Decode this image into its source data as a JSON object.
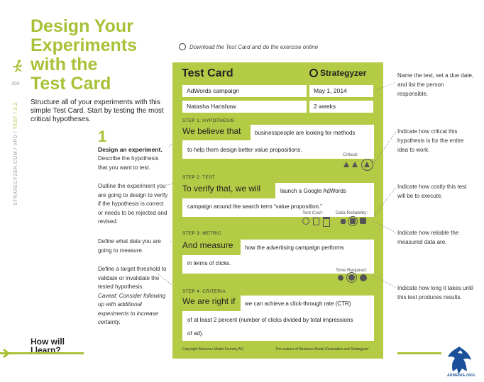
{
  "page": {
    "title_lines": [
      "Design Your",
      "Experiments",
      "with the",
      "Test Card"
    ],
    "page_number": "204",
    "side_text_main": "STRATEGYZER.COM / VPD / ",
    "side_text_accent": "TEST / 3.2",
    "intro": "Structure all of your experiments with this simple Test Card. Start by testing the most critical hypotheses.",
    "step_number": "1",
    "step_heading": "Design an experiment.",
    "step_desc": "Describe the hypothesis that you want to test.",
    "left_notes": [
      "Outline the experiment you are going to design to verify if the hypothesis is correct or needs to be rejected and revised.",
      "Define what data you are going to measure."
    ],
    "threshold_note": "Define a target threshold to validate or invalidate the tested hypothesis.",
    "caveat_note": "Caveat: Consider following up with additional experiments to increase certainty.",
    "how_will": [
      "How will",
      "I learn?"
    ],
    "download": "Download the Test Card and do the exercise online"
  },
  "card": {
    "title": "Test Card",
    "brand": "Strategyzer",
    "test_name": "AdWords campaign",
    "date": "May 1, 2014",
    "person": "Natasha Hanshaw",
    "duration": "2 weeks",
    "step1": {
      "label": "STEP 1: HYPOTHESIS",
      "lead": "We believe that",
      "line1": "businesspeople are looking for methods",
      "line2": "to help them design better value propositions.",
      "indicator_label": "Critical:"
    },
    "step2": {
      "label": "STEP 2: TEST",
      "lead": "To verify that, we will",
      "line1": "launch a Google AdWords",
      "line2": "campaign around the search term “value proposition.”",
      "cost_label": "Test Cost:",
      "reliability_label": "Data Reliability:"
    },
    "step3": {
      "label": "STEP 3: METRIC",
      "lead": "And measure",
      "line1": "how the advertising campaign performs",
      "line2": "in terms of clicks.",
      "time_label": "Time Required:"
    },
    "step4": {
      "label": "STEP 4: CRITERIA",
      "lead": "We are right if",
      "line1": "we can achieve a click-through rate (CTR)",
      "line2": "of at least 2 percent (number of clicks divided by total impressions",
      "line3": "of ad)."
    },
    "footer_left": "Copyright Business Model Foundry AG",
    "footer_right": "The makers of Business Model Generation and Strategyzer"
  },
  "right_notes": [
    "Name the test, set a due date, and list the person responsible.",
    "Indicate how critical this hypothesis is for the entire idea to work.",
    "Indicate how costly this test will be to execute.",
    "Indicate how reliable the measured data are.",
    "Indicate how long it takes until this test produces results."
  ],
  "watermark": "ARMENIA.ORG",
  "colors": {
    "accent": "#a8c238",
    "card": "#b4cc45",
    "watermark": "#1b4f9a"
  }
}
